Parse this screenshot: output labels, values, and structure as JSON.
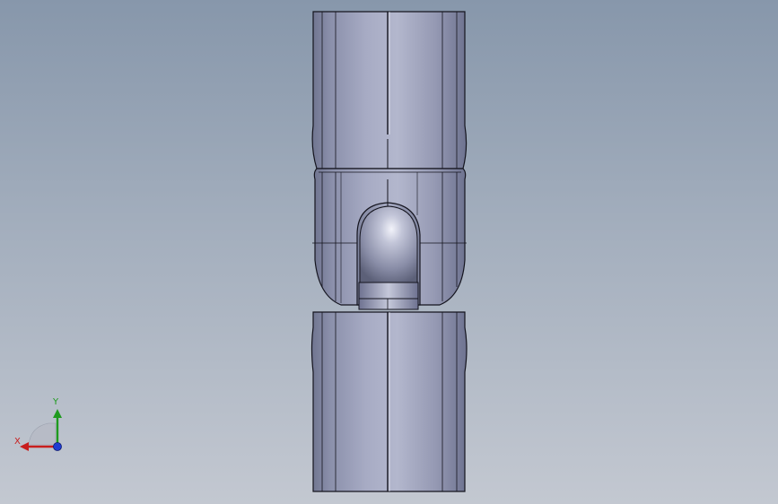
{
  "viewport": {
    "background_top": "#8797ab",
    "background_bottom": "#c3c8d1",
    "part_color": "#9ea3bd",
    "edge_color": "#14141e"
  },
  "triad": {
    "x_label": "X",
    "y_label": "Y",
    "x_color": "#c81e1e",
    "y_color": "#1e9a1e",
    "z_color": "#1e3cd2"
  }
}
